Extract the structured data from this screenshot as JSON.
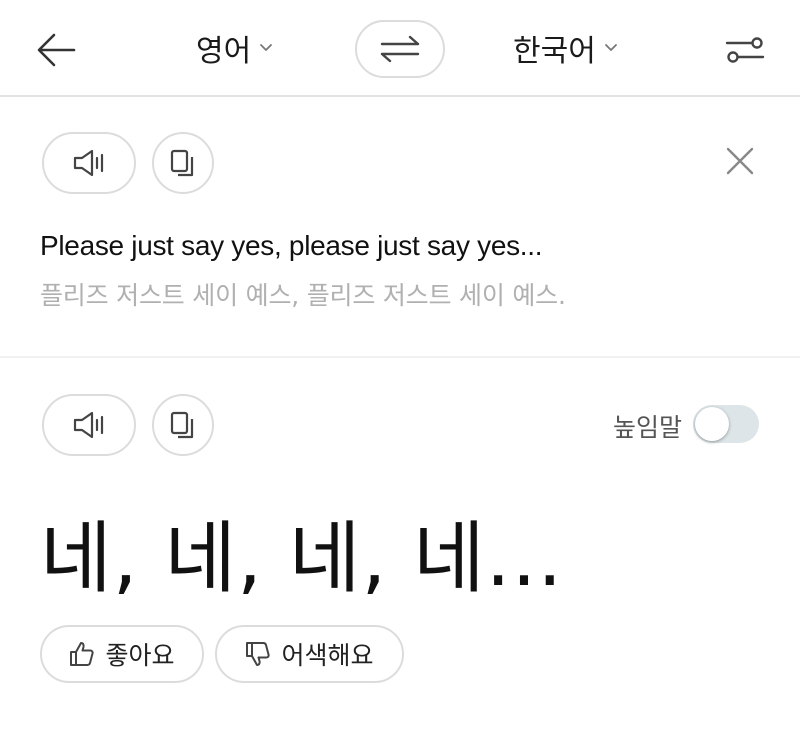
{
  "header": {
    "source_lang": "영어",
    "target_lang": "한국어"
  },
  "source": {
    "text": "Please just say yes, please just say yes...",
    "pronunciation": "플리즈 저스트 세이 예스, 플리즈 저스트 세이 예스."
  },
  "result": {
    "honorific_label": "높임말",
    "honorific_on": false,
    "text": "네, 네, 네, 네..."
  },
  "feedback": {
    "like_label": "좋아요",
    "dislike_label": "어색해요"
  },
  "icons": {
    "back": "arrow-left-icon",
    "chevron": "chevron-down-icon",
    "swap": "swap-arrows-icon",
    "settings": "sliders-icon",
    "speaker": "speaker-icon",
    "copy": "copy-icon",
    "close": "close-icon",
    "thumb_up": "thumb-up-icon",
    "thumb_down": "thumb-down-icon"
  },
  "colors": {
    "border": "#dcdcdc",
    "pronunciation": "#b0b0b0",
    "toggle_off": "#dde5e8"
  }
}
